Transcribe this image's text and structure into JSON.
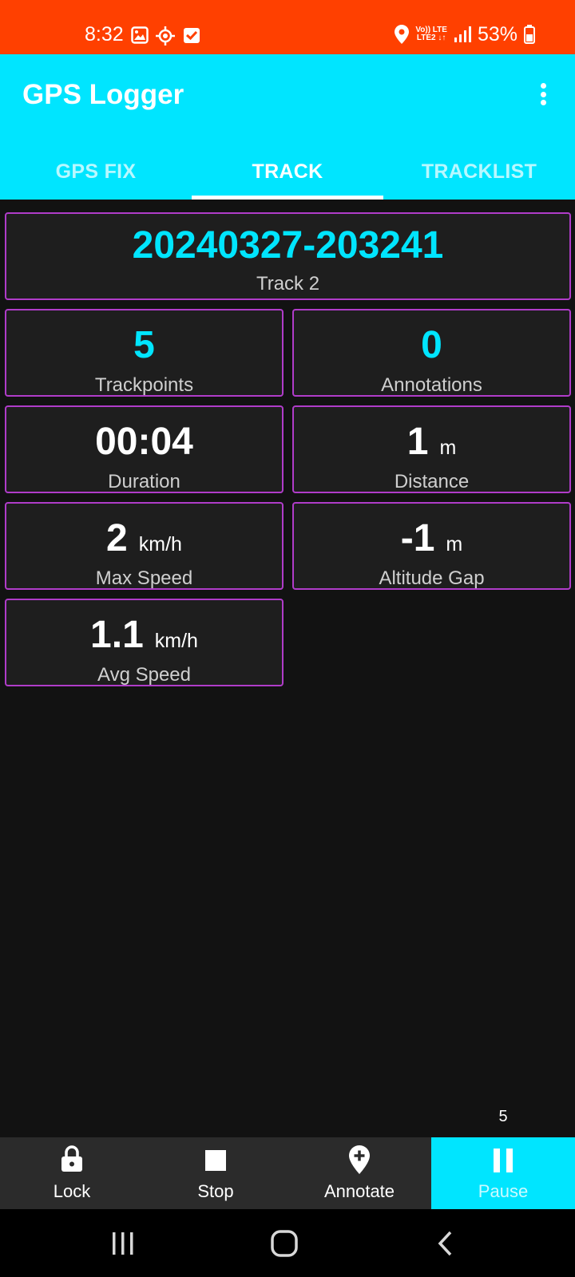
{
  "status_bar": {
    "time": "8:32",
    "network_top": "Vo)) LTE",
    "network_bottom": "LTE2 ↓↑",
    "battery": "53%",
    "icons": [
      "image-icon",
      "sync-icon",
      "check-box-icon",
      "location-icon",
      "signal-icon",
      "battery-icon"
    ]
  },
  "app_bar": {
    "title": "GPS Logger",
    "tabs": [
      {
        "label": "GPS FIX",
        "active": false
      },
      {
        "label": "TRACK",
        "active": true
      },
      {
        "label": "TRACKLIST",
        "active": false
      }
    ]
  },
  "track": {
    "name": "20240327-203241",
    "subtitle": "Track 2"
  },
  "stats": {
    "trackpoints": {
      "value": "5",
      "label": "Trackpoints"
    },
    "annotations": {
      "value": "0",
      "label": "Annotations"
    },
    "duration": {
      "value": "00:04",
      "label": "Duration"
    },
    "distance": {
      "value": "1",
      "unit": "m",
      "label": "Distance"
    },
    "max_speed": {
      "value": "2",
      "unit": "km/h",
      "label": "Max Speed"
    },
    "altitude_gap": {
      "value": "-1",
      "unit": "m",
      "label": "Altitude Gap"
    },
    "avg_speed": {
      "value": "1.1",
      "unit": "km/h",
      "label": "Avg Speed"
    }
  },
  "point_count": "5",
  "actions": [
    {
      "label": "Lock",
      "icon": "lock-icon"
    },
    {
      "label": "Stop",
      "icon": "stop-icon"
    },
    {
      "label": "Annotate",
      "icon": "add-location-icon"
    },
    {
      "label": "Pause",
      "icon": "pause-icon"
    }
  ],
  "colors": {
    "status_bar": "#ff4000",
    "accent": "#00e5ff",
    "card_border": "#b03cc9",
    "background": "#121212",
    "card_bg": "#1e1e1e"
  }
}
